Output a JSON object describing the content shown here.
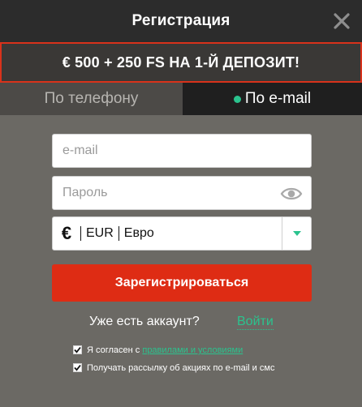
{
  "header": {
    "title": "Регистрация",
    "close_icon": "close-icon"
  },
  "promo": {
    "text": "€ 500 + 250 FS НА 1-Й ДЕПОЗИТ!"
  },
  "tabs": [
    {
      "label": "По телефону",
      "active": false
    },
    {
      "label": "По e-mail",
      "active": true
    }
  ],
  "form": {
    "email_placeholder": "e-mail",
    "password_placeholder": "Пароль",
    "password_icon": "eye-icon",
    "currency": {
      "symbol": "€",
      "code": "EUR",
      "name": "Евро",
      "dropdown_icon": "chevron-down-icon"
    },
    "submit_label": "Зарегистрироваться"
  },
  "login": {
    "question": "Уже есть аккаунт?",
    "link": "Войти"
  },
  "checkboxes": {
    "terms": {
      "checked": true,
      "prefix": "Я согласен с ",
      "link": "правилами и условиями"
    },
    "newsletter": {
      "checked": true,
      "text": "Получать рассылку об акциях по e-mail и смс"
    }
  },
  "colors": {
    "accent": "#2bc38e",
    "primary": "#de2c14",
    "panel": "#6b6964",
    "header": "#2c2c2c"
  }
}
